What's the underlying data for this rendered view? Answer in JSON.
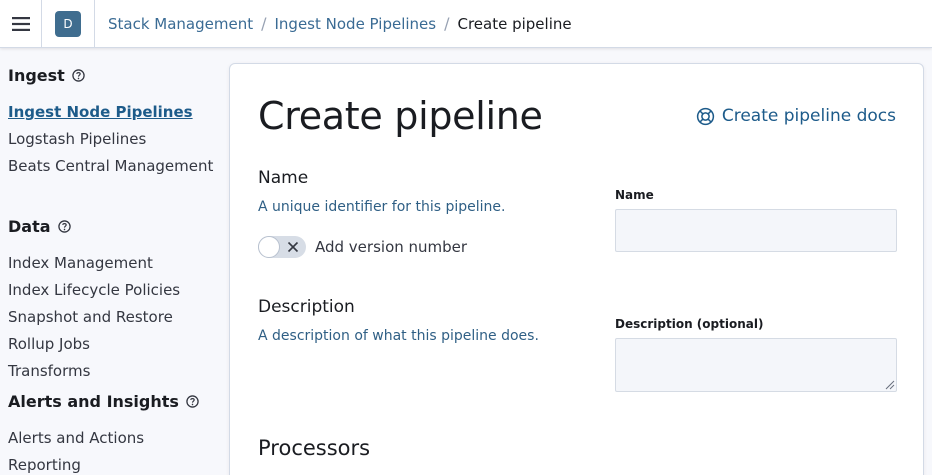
{
  "header": {
    "space_initial": "D",
    "breadcrumbs": [
      "Stack Management",
      "Ingest Node Pipelines",
      "Create pipeline"
    ]
  },
  "sidebar": {
    "groups": [
      {
        "title": "Ingest",
        "items": [
          "Ingest Node Pipelines",
          "Logstash Pipelines",
          "Beats Central Management"
        ],
        "active_index": 0
      },
      {
        "title": "Data",
        "items": [
          "Index Management",
          "Index Lifecycle Policies",
          "Snapshot and Restore",
          "Rollup Jobs",
          "Transforms"
        ]
      },
      {
        "title": "Alerts and Insights",
        "items": [
          "Alerts and Actions",
          "Reporting"
        ]
      }
    ]
  },
  "main": {
    "title": "Create pipeline",
    "docs_link": "Create pipeline docs",
    "name_section": {
      "title": "Name",
      "description": "A unique identifier for this pipeline.",
      "toggle_label": "Add version number",
      "toggle_on": false,
      "field_label": "Name",
      "value": ""
    },
    "description_section": {
      "title": "Description",
      "description": "A description of what this pipeline does.",
      "field_label": "Description (optional)",
      "value": ""
    },
    "processors_title": "Processors"
  },
  "colors": {
    "link": "#1d5b8a",
    "avatar": "#3f6d8f",
    "border": "#d3dae6",
    "page_bg": "#f7f8fc"
  },
  "icons": {
    "menu": "hamburger-icon",
    "help": "question-circle-icon",
    "docs": "help-lifebuoy-icon",
    "toggle": "cross-icon"
  }
}
